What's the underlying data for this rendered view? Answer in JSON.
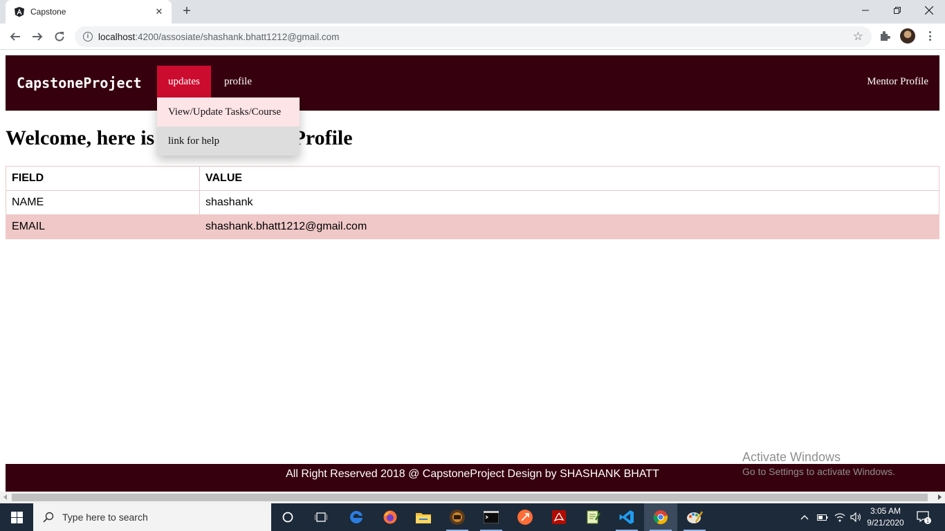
{
  "browser": {
    "tab_title": "Capstone",
    "url_host": "localhost",
    "url_path": ":4200/assosiate/shashank.bhatt1212@gmail.com"
  },
  "navbar": {
    "brand": "CapstoneProject",
    "items": [
      {
        "label": "updates"
      },
      {
        "label": "profile"
      }
    ],
    "right_label": "Mentor Profile",
    "dropdown": [
      {
        "label": "View/Update Tasks/Course"
      },
      {
        "label": "link for help"
      }
    ]
  },
  "main": {
    "heading": "Welcome, here is your Associate Profile",
    "table": {
      "headers": [
        "FIELD",
        "VALUE"
      ],
      "rows": [
        [
          "NAME",
          "shashank"
        ],
        [
          "EMAIL",
          "shashank.bhatt1212@gmail.com"
        ]
      ]
    }
  },
  "footer": {
    "text": "All Right Reserved 2018 @ CapstoneProject Design by SHASHANK BHATT"
  },
  "watermark": {
    "title": "Activate Windows",
    "subtitle": "Go to Settings to activate Windows."
  },
  "taskbar": {
    "search_placeholder": "Type here to search",
    "time": "3:05 AM",
    "date": "9/21/2020",
    "notification_count": "1"
  },
  "colors": {
    "navbar_bg": "#37000f",
    "active_nav": "#cc0c2f",
    "row_alt": "#f0c8c8",
    "dropdown_hover": "#fde4e7"
  }
}
